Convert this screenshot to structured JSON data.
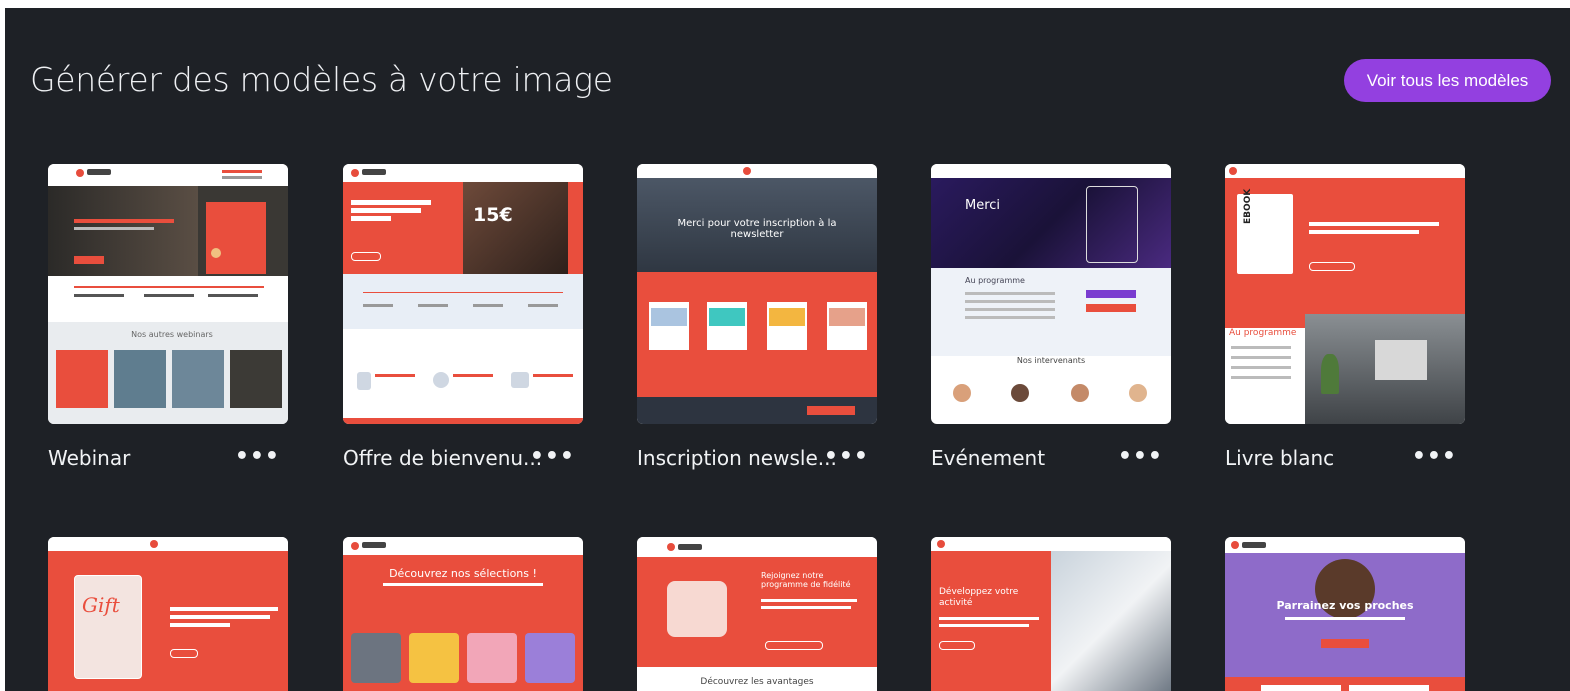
{
  "header": {
    "title": "Générer des modèles à votre image",
    "view_all_label": "Voir tous les modèles"
  },
  "templates_row1": [
    {
      "label": "Webinar"
    },
    {
      "label": "Offre de bienvenu..."
    },
    {
      "label": "Inscription newsle..."
    },
    {
      "label": "Evénement"
    },
    {
      "label": "Livre blanc"
    }
  ],
  "thumb_text": {
    "price": "15€",
    "merci_newsletter": "Merci pour votre inscription à la newsletter",
    "merci": "Merci",
    "au_programme": "Au programme",
    "nos_intervenants": "Nos intervenants",
    "nos_webinars": "Nos autres webinars",
    "ebook": "EBOOK",
    "gift": "Gift",
    "decouvrez_selections": "Découvrez nos sélections !",
    "rejoignez": "Rejoignez notre programme de fidélité",
    "decouvrez_avantages": "Découvrez les avantages",
    "developpez": "Développez votre activité",
    "parrainez": "Parrainez vos proches"
  },
  "more_icon": "more-horizontal-icon",
  "colors": {
    "background": "#1e2126",
    "accent": "#9340e0",
    "brand_red": "#e94e3d"
  }
}
